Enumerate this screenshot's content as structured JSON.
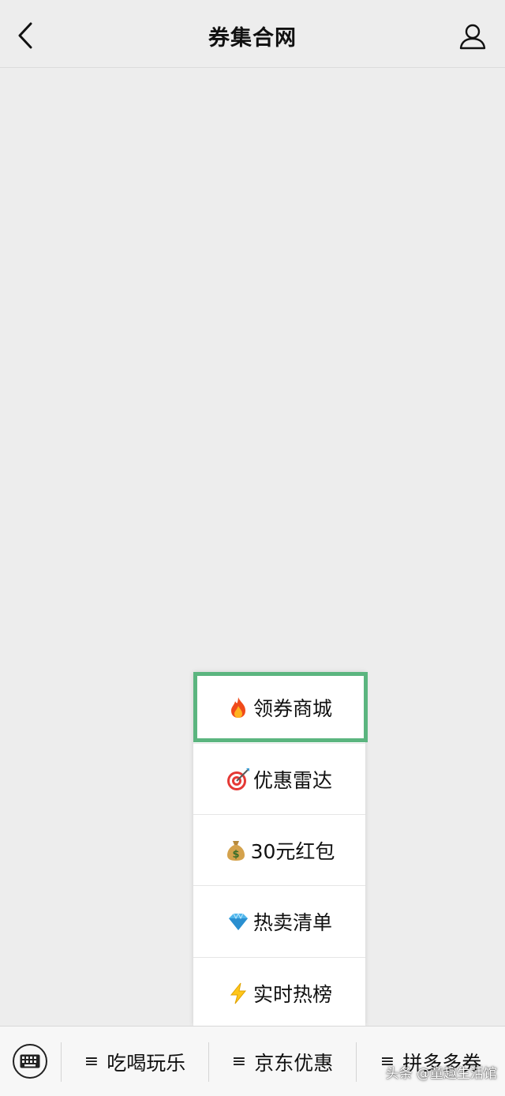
{
  "header": {
    "title": "券集合网",
    "back_icon": "chevron-left-icon",
    "profile_icon": "person-icon"
  },
  "popup_menu": {
    "items": [
      {
        "icon": "fire-icon",
        "label": "领券商城"
      },
      {
        "icon": "target-icon",
        "label": "优惠雷达"
      },
      {
        "icon": "money-bag-icon",
        "label": "30元红包"
      },
      {
        "icon": "diamond-icon",
        "label": "热卖清单"
      },
      {
        "icon": "lightning-icon",
        "label": "实时热榜"
      }
    ],
    "highlight_color": "#5bb57f"
  },
  "bottom_bar": {
    "keyboard_icon": "keyboard-icon",
    "tabs": [
      {
        "label": "吃喝玩乐"
      },
      {
        "label": "京东优惠"
      },
      {
        "label": "拼多多券"
      }
    ]
  },
  "watermark": "头条 @童趣生活馆"
}
